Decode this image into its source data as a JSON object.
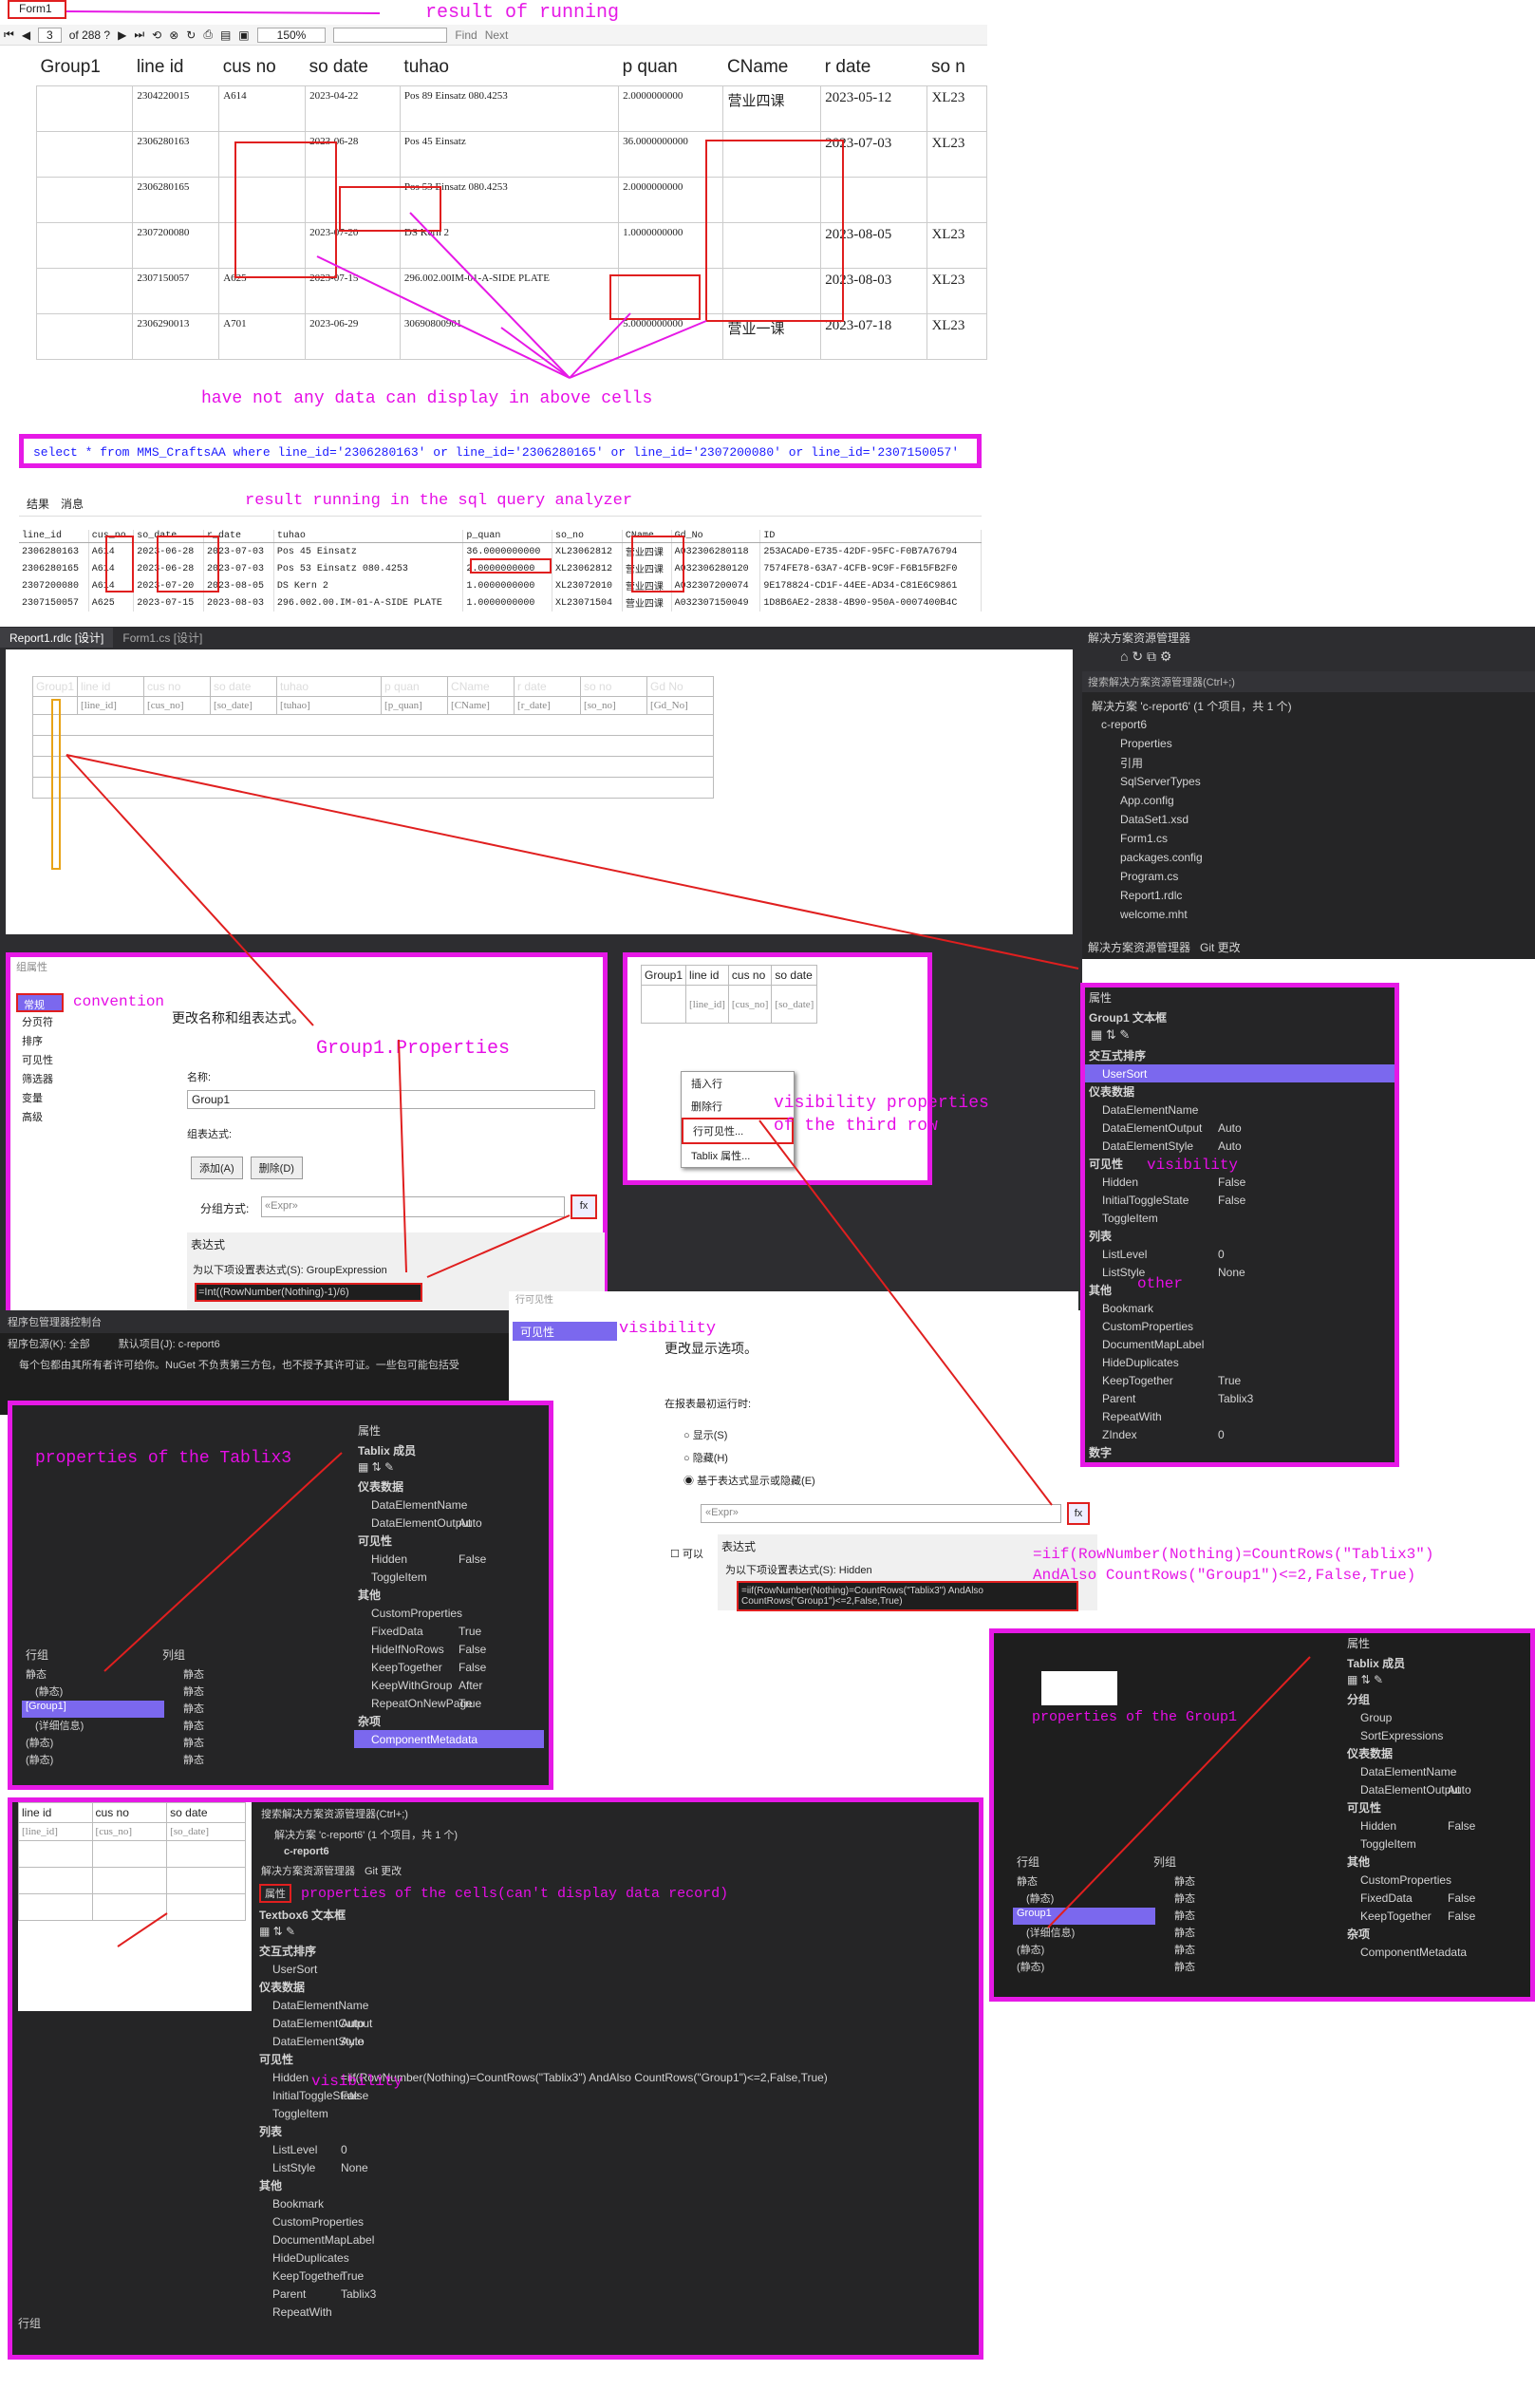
{
  "viewer": {
    "title": "Form1",
    "page": "3",
    "of": "of 288 ?",
    "zoom": "150%",
    "find": "Find",
    "next": "Next"
  },
  "notes": {
    "result_running": "result of running",
    "no_data": "have not any data can display in above cells",
    "sql_result": "result running in the sql query analyzer",
    "convention": "convention",
    "group1_props": "Group1.Properties",
    "vis_third_row": "visibility properties of the third row",
    "visibility": "visibility",
    "other": "other",
    "tablix3_props": "properties of the Tablix3",
    "group1_props2": "properties of the Group1",
    "cell_props": "properties of the cells(can't display data record)",
    "expression": "=iif(RowNumber(Nothing)=CountRows(\"Tablix3\") AndAlso CountRows(\"Group1\")<=2,False,True)"
  },
  "report": {
    "headers": [
      "Group1",
      "line id",
      "cus no",
      "so date",
      "tuhao",
      "p quan",
      "CName",
      "r date",
      "so n"
    ],
    "rows": [
      [
        "",
        "2304220015",
        "A614",
        "2023-04-22",
        "Pos 89 Einsatz 080.4253",
        "2.0000000000",
        "营业四课",
        "2023-05-12",
        "XL23"
      ],
      [
        "",
        "2306280163",
        "",
        "2023-06-28",
        "Pos 45 Einsatz",
        "36.0000000000",
        "",
        "2023-07-03",
        "XL23"
      ],
      [
        "",
        "2306280165",
        "",
        "",
        "Pos 53 Einsatz 080.4253",
        "2.0000000000",
        "",
        "",
        ""
      ],
      [
        "",
        "2307200080",
        "",
        "2023-07-20",
        "DS Kern 2",
        "1.0000000000",
        "",
        "2023-08-05",
        "XL23"
      ],
      [
        "",
        "2307150057",
        "A625",
        "2023-07-15",
        "296.002.00IM-01-A-SIDE PLATE",
        "",
        "",
        "2023-08-03",
        "XL23"
      ],
      [
        "",
        "2306290013",
        "A701",
        "2023-06-29",
        "30690800901",
        "5.0000000000",
        "营业一课",
        "2023-07-18",
        "XL23"
      ]
    ]
  },
  "sql": {
    "query": "select * from MMS_CraftsAA where line_id='2306280163' or line_id='2306280165' or line_id='2307200080' or line_id='2307150057'",
    "tabs": [
      "结果",
      "消息"
    ],
    "headers": [
      "line_id",
      "cus_no",
      "so_date",
      "r_date",
      "tuhao",
      "p_quan",
      "so_no",
      "CName",
      "Gd_No",
      "ID"
    ],
    "rows": [
      [
        "2306280163",
        "A614",
        "2023-06-28",
        "2023-07-03",
        "Pos 45 Einsatz",
        "36.0000000000",
        "XL23062812",
        "营业四课",
        "A032306280118",
        "253ACAD0-E735-42DF-95FC-F0B7A76794"
      ],
      [
        "2306280165",
        "A614",
        "2023-06-28",
        "2023-07-03",
        "Pos 53 Einsatz 080.4253",
        "2.0000000000",
        "XL23062812",
        "营业四课",
        "A032306280120",
        "7574FE78-63A7-4CFB-9C9F-F6B15FB2F0"
      ],
      [
        "2307200080",
        "A614",
        "2023-07-20",
        "2023-08-05",
        "DS Kern 2",
        "1.0000000000",
        "XL23072010",
        "营业四课",
        "A032307200074",
        "9E178824-CD1F-44EE-AD34-C81E6C9861"
      ],
      [
        "2307150057",
        "A625",
        "2023-07-15",
        "2023-08-03",
        "296.002.00.IM-01-A-SIDE PLATE",
        "1.0000000000",
        "XL23071504",
        "营业四课",
        "A032307150049",
        "1D8B6AE2-2838-4B90-950A-0007400B4C"
      ]
    ]
  },
  "designer": {
    "tabs": [
      "Report1.rdlc [设计]",
      "Form1.cs [设计]"
    ],
    "headers": [
      "Group1",
      "line id",
      "cus no",
      "so date",
      "tuhao",
      "p quan",
      "CName",
      "r date",
      "so no",
      "Gd No"
    ],
    "fields": [
      "",
      "[line_id]",
      "[cus_no]",
      "[so_date]",
      "[tuhao]",
      "[p_quan]",
      "[CName]",
      "[r_date]",
      "[so_no]",
      "[Gd_No]"
    ]
  },
  "solution": {
    "title": "解决方案资源管理器",
    "search": "搜索解决方案资源管理器(Ctrl+;)",
    "items": [
      "解决方案 'c-report6' (1 个项目，共 1 个)",
      "c-report6",
      "Properties",
      "引用",
      "SqlServerTypes",
      "App.config",
      "DataSet1.xsd",
      "Form1.cs",
      "packages.config",
      "Program.cs",
      "Report1.rdlc",
      "welcome.mht"
    ],
    "tabs": [
      "解决方案资源管理器",
      "Git 更改"
    ]
  },
  "props1": {
    "title": "属性",
    "object": "Group1 文本框",
    "rows": [
      {
        "h": "交互式排序"
      },
      {
        "k": "UserSort",
        "v": "",
        "sel": true
      },
      {
        "h": "仪表数据"
      },
      {
        "k": "DataElementName",
        "v": ""
      },
      {
        "k": "DataElementOutput",
        "v": "Auto"
      },
      {
        "k": "DataElementStyle",
        "v": "Auto"
      },
      {
        "h": "可见性"
      },
      {
        "k": "Hidden",
        "v": "False"
      },
      {
        "k": "InitialToggleState",
        "v": "False"
      },
      {
        "k": "ToggleItem",
        "v": ""
      },
      {
        "h": "列表"
      },
      {
        "k": "ListLevel",
        "v": "0"
      },
      {
        "k": "ListStyle",
        "v": "None"
      },
      {
        "h": "其他"
      },
      {
        "k": "Bookmark",
        "v": ""
      },
      {
        "k": "CustomProperties",
        "v": ""
      },
      {
        "k": "DocumentMapLabel",
        "v": ""
      },
      {
        "k": "HideDuplicates",
        "v": ""
      },
      {
        "k": "KeepTogether",
        "v": "True"
      },
      {
        "k": "Parent",
        "v": "Tablix3"
      },
      {
        "k": "RepeatWith",
        "v": ""
      },
      {
        "k": "ZIndex",
        "v": "0"
      },
      {
        "h": "数字"
      }
    ]
  },
  "groupdlg": {
    "title": "组属性",
    "nav": [
      "常规",
      "分页符",
      "排序",
      "可见性",
      "筛选器",
      "变量",
      "高级"
    ],
    "heading": "更改名称和组表达式。",
    "name_label": "名称:",
    "name_value": "Group1",
    "expr_label": "组表达式:",
    "add": "添加(A)",
    "del": "删除(D)",
    "group_on": "分组方式:",
    "expr_ph": "«Expr»",
    "fx": "fx",
    "expr_title": "表达式",
    "expr_for": "为以下项设置表达式(S): GroupExpression",
    "expr": "=Int((RowNumber(Nothing)-1)/6)"
  },
  "ctx": {
    "items": [
      "插入行",
      "删除行",
      "行可见性...",
      "Tablix 属性..."
    ]
  },
  "pm": {
    "title": "程序包管理器控制台",
    "source": "程序包源(K): 全部",
    "project": "默认项目(J): c-report6",
    "msg": "每个包都由其所有者许可给你。NuGet 不负责第三方包，也不授予其许可证。一些包可能包括受"
  },
  "visdlg": {
    "nav": "可见性",
    "title_nav": "行可见性",
    "heading": "更改显示选项。",
    "when": "在报表最初运行时:",
    "opts": [
      "显示(S)",
      "隐藏(H)",
      "基于表达式显示或隐藏(E)"
    ],
    "expr_ph": "«Expr»",
    "expr_title": "表达式",
    "expr_for": "为以下项设置表达式(S): Hidden",
    "expr": "=iif(RowNumber(Nothing)=CountRows(\"Tablix3\") AndAlso CountRows(\"Group1\")<=2,False,True)",
    "cb": "可以"
  },
  "tablix3": {
    "title": "属性",
    "object": "Tablix 成员",
    "rows": [
      {
        "h": "仪表数据"
      },
      {
        "k": "DataElementName",
        "v": ""
      },
      {
        "k": "DataElementOutput",
        "v": "Auto"
      },
      {
        "h": "可见性"
      },
      {
        "k": "Hidden",
        "v": "False"
      },
      {
        "k": "ToggleItem",
        "v": ""
      },
      {
        "h": "其他"
      },
      {
        "k": "CustomProperties",
        "v": ""
      },
      {
        "k": "FixedData",
        "v": "True"
      },
      {
        "k": "HideIfNoRows",
        "v": "False"
      },
      {
        "k": "KeepTogether",
        "v": "False"
      },
      {
        "k": "KeepWithGroup",
        "v": "After"
      },
      {
        "k": "RepeatOnNewPage",
        "v": "True"
      },
      {
        "h": "杂项"
      },
      {
        "k": "ComponentMetadata",
        "v": "",
        "sel": true
      }
    ],
    "rowgroups": "行组",
    "colgroups": "列组",
    "members": [
      "静态",
      "(静态)",
      "[Group1]",
      "(详细信息)",
      "(静态)",
      "(静态)"
    ],
    "colmembers": [
      "静态",
      "静态",
      "静态",
      "静态",
      "静态",
      "静态"
    ]
  },
  "group1p": {
    "title": "属性",
    "object": "Tablix 成员",
    "rows": [
      {
        "h": "分组"
      },
      {
        "k": "Group",
        "v": ""
      },
      {
        "k": "SortExpressions",
        "v": ""
      },
      {
        "h": "仪表数据"
      },
      {
        "k": "DataElementName",
        "v": ""
      },
      {
        "k": "DataElementOutput",
        "v": "Auto"
      },
      {
        "h": "可见性"
      },
      {
        "k": "Hidden",
        "v": "False"
      },
      {
        "k": "ToggleItem",
        "v": ""
      },
      {
        "h": "其他"
      },
      {
        "k": "CustomProperties",
        "v": ""
      },
      {
        "k": "FixedData",
        "v": "False"
      },
      {
        "k": "KeepTogether",
        "v": "False"
      },
      {
        "h": "杂项"
      },
      {
        "k": "ComponentMetadata",
        "v": ""
      }
    ],
    "rowgroups": "行组",
    "colgroups": "列组",
    "members": [
      "静态",
      "(静态)",
      "Group1",
      "(详细信息)",
      "(静态)",
      "(静态)"
    ],
    "colmembers": [
      "静态",
      "静态",
      "静态",
      "静态",
      "静态",
      "静态"
    ]
  },
  "cellp": {
    "search": "搜索解决方案资源管理器(Ctrl+;)",
    "sol": "解决方案 'c-report6' (1 个项目，共 1 个)",
    "proj": "c-report6",
    "tabs": [
      "解决方案资源管理器",
      "Git 更改"
    ],
    "title": "属性",
    "object": "Textbox6 文本框",
    "rows": [
      {
        "h": "交互式排序"
      },
      {
        "k": "UserSort",
        "v": ""
      },
      {
        "h": "仪表数据"
      },
      {
        "k": "DataElementName",
        "v": ""
      },
      {
        "k": "DataElementOutput",
        "v": "Auto"
      },
      {
        "k": "DataElementStyle",
        "v": "Auto"
      },
      {
        "h": "可见性"
      },
      {
        "k": "Hidden",
        "v": "=iif(RowNumber(Nothing)=CountRows(\"Tablix3\") AndAlso CountRows(\"Group1\")<=2,False,True)"
      },
      {
        "k": "InitialToggleState",
        "v": "False"
      },
      {
        "k": "ToggleItem",
        "v": ""
      },
      {
        "h": "列表"
      },
      {
        "k": "ListLevel",
        "v": "0"
      },
      {
        "k": "ListStyle",
        "v": "None"
      },
      {
        "h": "其他"
      },
      {
        "k": "Bookmark",
        "v": ""
      },
      {
        "k": "CustomProperties",
        "v": ""
      },
      {
        "k": "DocumentMapLabel",
        "v": ""
      },
      {
        "k": "HideDuplicates",
        "v": ""
      },
      {
        "k": "KeepTogether",
        "v": "True"
      },
      {
        "k": "Parent",
        "v": "Tablix3"
      },
      {
        "k": "RepeatWith",
        "v": ""
      }
    ],
    "rowgroups": "行组"
  },
  "cellgrid": {
    "headers": [
      "line id",
      "cus no",
      "so date"
    ],
    "fields": [
      "[line_id]",
      "[cus_no]",
      "[so_date]"
    ]
  },
  "colors": {
    "magenta": "#e619e6",
    "red": "#e01f1f",
    "select": "#7b68ee"
  }
}
